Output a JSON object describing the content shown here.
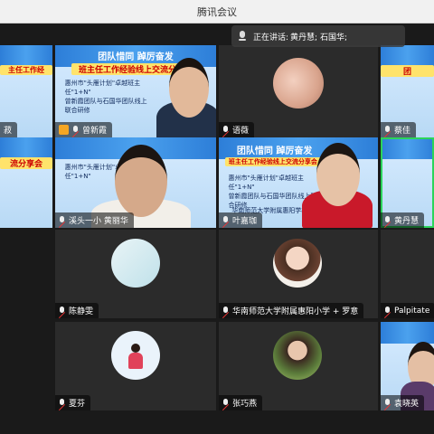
{
  "window": {
    "title": "腾讯会议"
  },
  "speaking": {
    "label": "正在讲话:",
    "names": "黄丹慧; 石国华;"
  },
  "slide": {
    "title": "团队惜同 踔厉奋发",
    "banner": "班主任工作经验线上交流分享会",
    "line1": "惠州市\"头雁计划\"卓越班主任\"1+N\"",
    "line2": "曾新霞团队与石国华团队线上联合研修",
    "host": "华南师范大学附属惠阳学校",
    "org": "博罗县第一小学(惠博罗县博罗小学)",
    "partial_left_title": "主任工作经",
    "partial_banner": "流分享会",
    "partial_right_title": "团"
  },
  "participants": [
    {
      "name": "",
      "tile": "r1c1"
    },
    {
      "name": "曾新霞",
      "tile": "r1c2"
    },
    {
      "name": "语薇",
      "tile": "r1c3"
    },
    {
      "name": "蔡佳",
      "tile": "r1c4"
    },
    {
      "name": "溪头一小 黄丽华",
      "tile": "r2c2"
    },
    {
      "name": "叶嘉珈",
      "tile": "r2c3"
    },
    {
      "name": "黄丹慧",
      "tile": "r2c4"
    },
    {
      "name": "陈静雯",
      "tile": "r3c2"
    },
    {
      "name": "华南师范大学附属惠阳小学 + 罗意",
      "tile": "r3c3"
    },
    {
      "name": "Palpitate",
      "tile": "r3c4"
    },
    {
      "name": "夏芬",
      "tile": "r4c2"
    },
    {
      "name": "张巧燕",
      "tile": "r4c3"
    },
    {
      "name": "袁晓英",
      "tile": "r4c4"
    }
  ],
  "partial_names": {
    "r1c1": "菽",
    "r2c1": ""
  },
  "colors": {
    "active_speaker": "#2bd45a",
    "titlebar": "#f1f1f1"
  }
}
